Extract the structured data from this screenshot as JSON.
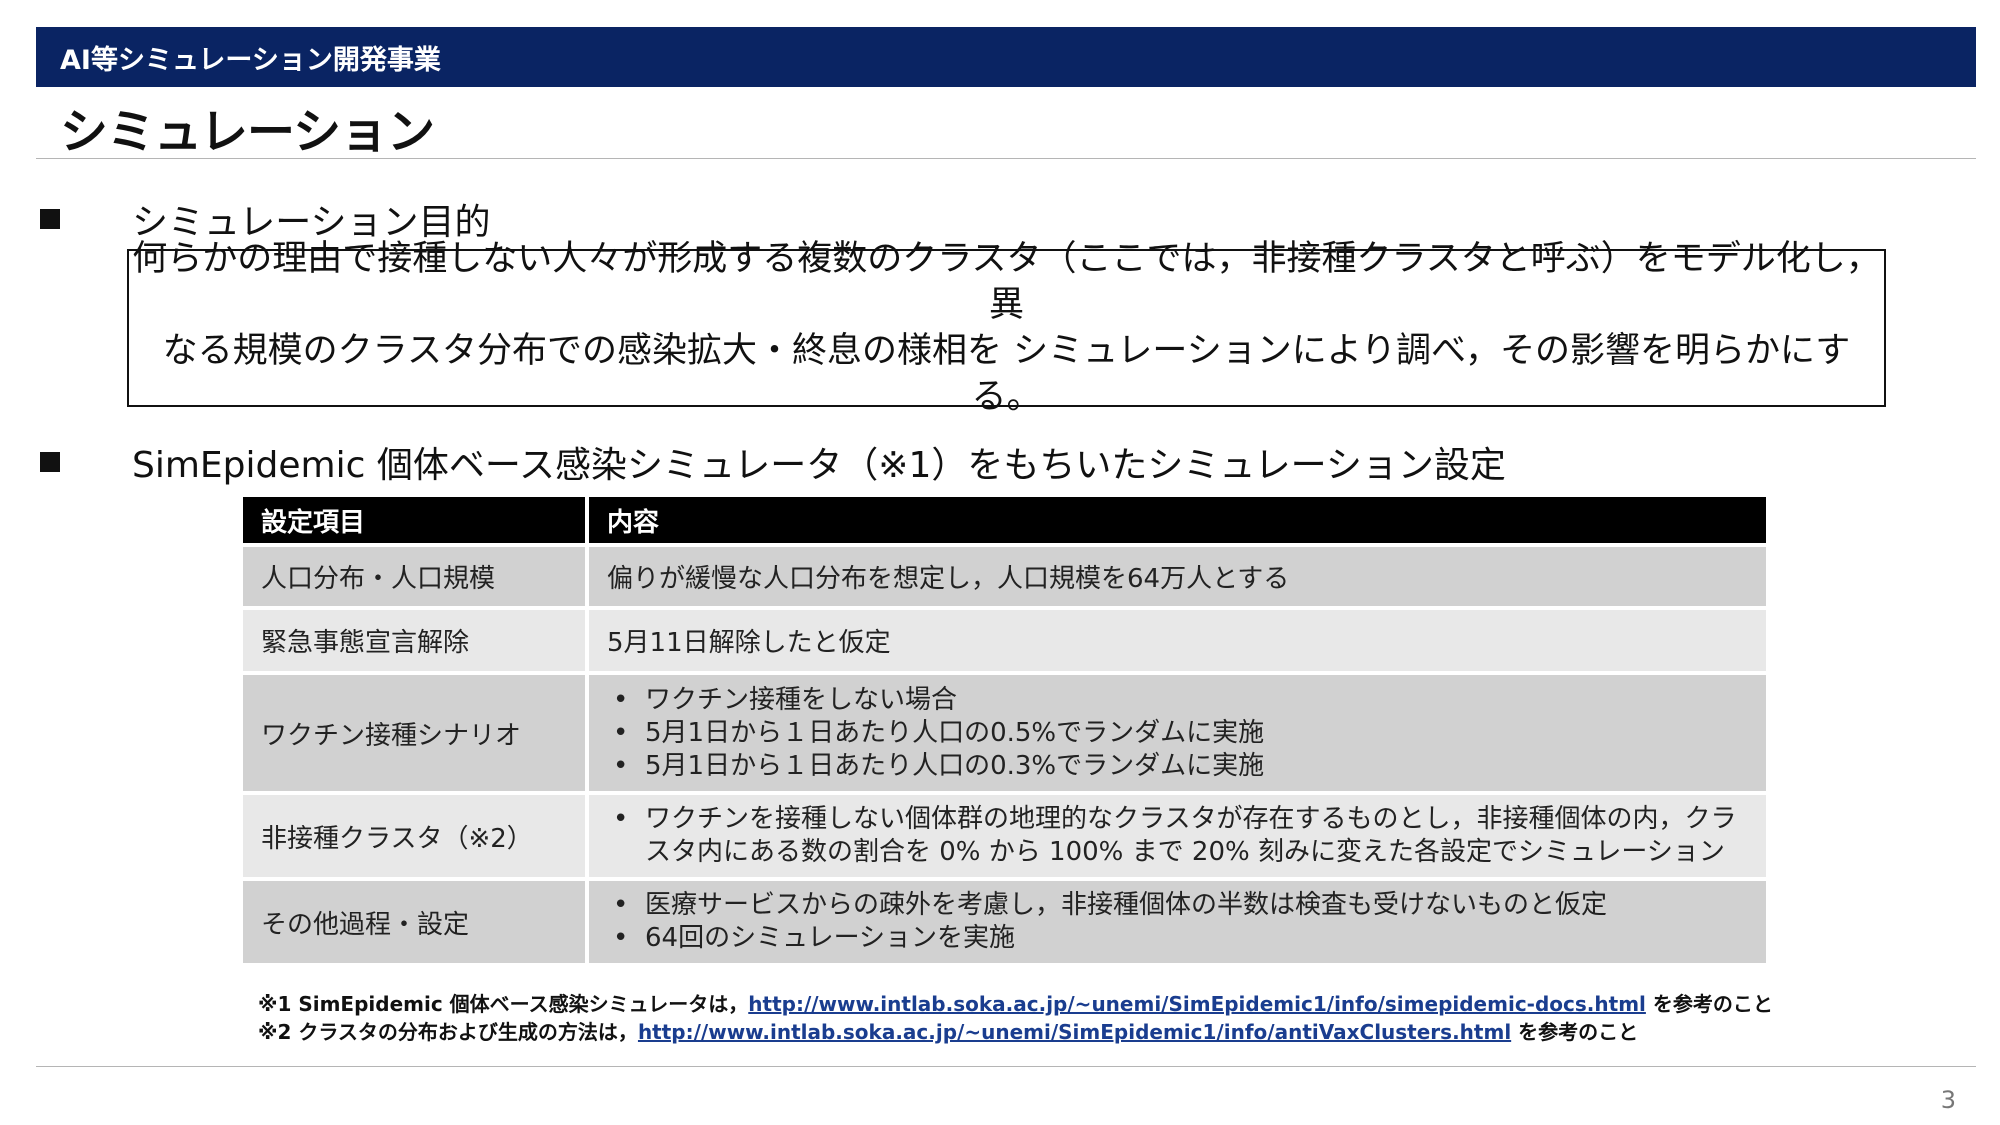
{
  "header": {
    "section": "AI等シミュレーション開発事業"
  },
  "page": {
    "title": "シミュレーション",
    "number": "3"
  },
  "purpose": {
    "heading": "シミュレーション目的",
    "lines": [
      "何らかの理由で接種しない人々が形成する複数のクラスタ（ここでは，非接種クラスタと呼ぶ）をモデル化し，異",
      "なる規模のクラスタ分布での感染拡大・終息の様相を シミュレーションにより調べ，その影響を明らかにする。"
    ]
  },
  "settings": {
    "heading": "SimEpidemic 個体ベース感染シミュレータ（※1）をもちいたシミュレーション設定",
    "columns": [
      "設定項目",
      "内容"
    ],
    "rows": [
      {
        "item": "人口分布・人口規模",
        "content": [
          "偏りが緩慢な人口分布を想定し，人口規模を64万人とする"
        ]
      },
      {
        "item": "緊急事態宣言解除",
        "content": [
          "5月11日解除したと仮定"
        ]
      },
      {
        "item": "ワクチン接種シナリオ",
        "content": [
          "ワクチン接種をしない場合",
          "5月1日から１日あたり人口の0.5%でランダムに実施",
          "5月1日から１日あたり人口の0.3%でランダムに実施"
        ]
      },
      {
        "item": "非接種クラスタ（※2）",
        "content": [
          "ワクチンを接種しない個体群の地理的なクラスタが存在するものとし，非接種個体の内，クラスタ内にある数の割合を 0% から 100% まで 20% 刻みに変えた各設定でシミュレーション"
        ]
      },
      {
        "item": "その他過程・設定",
        "content": [
          "医療サービスからの疎外を考慮し，非接種個体の半数は検査も受けないものと仮定",
          "64回のシミュレーションを実施"
        ]
      }
    ]
  },
  "footnotes": [
    {
      "prefix": "※1 SimEpidemic 個体ベース感染シミュレータは，",
      "link": "http://www.intlab.soka.ac.jp/~unemi/SimEpidemic1/info/simepidemic-docs.html",
      "suffix": " を参考のこと"
    },
    {
      "prefix": "※2 クラスタの分布および生成の方法は，",
      "link": "http://www.intlab.soka.ac.jp/~unemi/SimEpidemic1/info/antiVaxClusters.html",
      "suffix": " を参考のこと"
    }
  ]
}
